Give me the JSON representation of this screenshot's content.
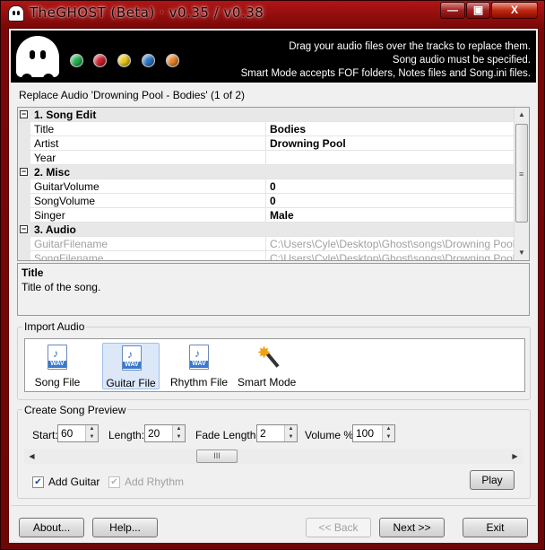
{
  "window": {
    "title": "TheGHOST (Beta) · v0.35 / v0.38",
    "min_glyph": "—",
    "max_glyph": "▣",
    "close_glyph": "X"
  },
  "header": {
    "message_lines": [
      "Drag your audio files over the tracks to replace them.",
      "Song audio must be specified.",
      "Smart Mode accepts FOF folders, Notes files and Song.ini files."
    ],
    "dot_colors": [
      "#22b24c",
      "#d0202a",
      "#e8c81a",
      "#2a78c8",
      "#e8842a"
    ]
  },
  "replace_label": "Replace Audio 'Drowning Pool - Bodies' (1 of 2)",
  "property_grid": {
    "rows": [
      {
        "kind": "category",
        "label": "1. Song Edit",
        "expander": "−"
      },
      {
        "kind": "prop",
        "name": "Title",
        "value": "Bodies"
      },
      {
        "kind": "prop",
        "name": "Artist",
        "value": "Drowning Pool"
      },
      {
        "kind": "prop",
        "name": "Year",
        "value": ""
      },
      {
        "kind": "category",
        "label": "2. Misc",
        "expander": "−"
      },
      {
        "kind": "prop",
        "name": "GuitarVolume",
        "value": "0"
      },
      {
        "kind": "prop",
        "name": "SongVolume",
        "value": "0"
      },
      {
        "kind": "prop",
        "name": "Singer",
        "value": "Male"
      },
      {
        "kind": "category",
        "label": "3. Audio",
        "expander": "−"
      },
      {
        "kind": "prop-disabled",
        "name": "GuitarFilename",
        "value": "C:\\Users\\Cyle\\Desktop\\Ghost\\songs\\Drowning Pool-Bodies"
      },
      {
        "kind": "prop-disabled",
        "name": "SongFilename",
        "value": "C:\\Users\\Cyle\\Desktop\\Ghost\\songs\\Drowning Pool-Bodies"
      }
    ]
  },
  "description": {
    "title": "Title",
    "text": "Title of the song."
  },
  "import_audio": {
    "group_label": "Import Audio",
    "items": [
      {
        "label": "Song File",
        "icon": "wav-file-icon",
        "tag": "WAV"
      },
      {
        "label": "Guitar File",
        "icon": "wav-file-icon",
        "tag": "WAV",
        "selected": true
      },
      {
        "label": "Rhythm File",
        "icon": "wav-file-icon",
        "tag": "WAV"
      },
      {
        "label": "Smart Mode",
        "icon": "magic-wand-icon"
      }
    ]
  },
  "preview": {
    "group_label": "Create Song Preview",
    "start_label": "Start:",
    "start_value": "60",
    "length_label": "Length:",
    "length_value": "20",
    "fade_label": "Fade Length:",
    "fade_value": "2",
    "volume_label": "Volume %:",
    "volume_value": "100",
    "add_guitar_label": "Add Guitar",
    "add_guitar_checked": true,
    "add_rhythm_label": "Add Rhythm",
    "add_rhythm_checked": true,
    "play_label": "Play",
    "scroll_grip": "III"
  },
  "footer": {
    "about_label": "About...",
    "help_label": "Help...",
    "back_label": "<< Back",
    "next_label": "Next >>",
    "exit_label": "Exit"
  }
}
